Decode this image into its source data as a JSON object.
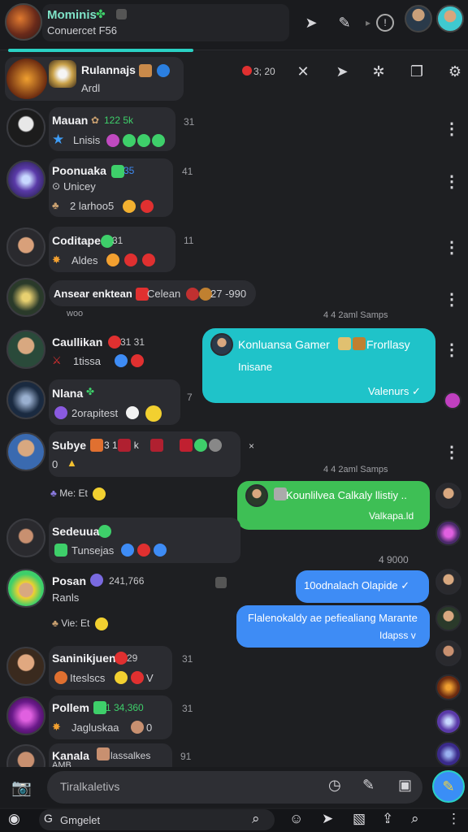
{
  "header": {
    "title": "Mominis",
    "title_emoji": "✤",
    "subtitle": "Conuercet F56",
    "icons": [
      "send-icon",
      "pencil-icon",
      "chevron-right-icon",
      "timer-icon"
    ]
  },
  "pinned": {
    "name": "Rulannajs",
    "line2": "Ardl",
    "count": "3; 20",
    "icons": [
      "close-icon",
      "send-icon",
      "settings-icon",
      "copy-icon",
      "gear-icon"
    ]
  },
  "rows": [
    {
      "name": "Mauan",
      "meta": "122 5k",
      "line2": "Lnisis",
      "num": "31"
    },
    {
      "name": "Poonuaka",
      "meta": "35",
      "line2": "Unicey",
      "line3": "2 larhoo5",
      "num": "41"
    },
    {
      "name": "Coditape",
      "meta": "31",
      "line2": "Aldes",
      "num": "11"
    },
    {
      "name": "Ansear enktean",
      "meta": "Celean",
      "extra": "27 -990",
      "sub": "woo"
    },
    {
      "name": "Caullikan",
      "meta": "31 31",
      "line2": "1tissa"
    },
    {
      "name": "Nlana",
      "line2": "2orapitest",
      "num": "7"
    },
    {
      "name": "Subye",
      "meta": "3   10   1 k",
      "line2": "0"
    },
    {
      "name": "Sedeuua",
      "line2": "Tunsejas"
    },
    {
      "name": "Posan",
      "meta": "241,766",
      "line2": "Ranls"
    },
    {
      "name": "Saninikjuen",
      "meta": "29",
      "line2": "Iteslscs",
      "tail": "V",
      "num": "31"
    },
    {
      "name": "Pollem",
      "meta": "1 34,360",
      "line2": "Jagluskaa",
      "tail": "0",
      "num": "31"
    },
    {
      "name": "Kanala",
      "meta": "lassalkes",
      "line2": "AMB",
      "num": "91"
    }
  ],
  "timestamps": [
    "4 4 2aml Samps",
    "4 4 2aml Samps",
    "4 9000"
  ],
  "side_labels": [
    "Me: Et",
    "Vie: Et"
  ],
  "side_marks": [
    "×"
  ],
  "messages": {
    "teal": {
      "title": "Konluansa Gamer",
      "title2": "Frorllasy",
      "body": "Inisane",
      "footer": "Valenurs ✓"
    },
    "green": {
      "title": "Kounlilvea Calkaly llistiy ..",
      "footer": "Valkapa.ld"
    },
    "blue1": {
      "title": "10odnalach Olapide ✓"
    },
    "blue2": {
      "title": "Flalenokaldy ae pefiealiang Marante",
      "footer": "Idapss v"
    }
  },
  "composer": {
    "placeholder": "Tiralkaletivs"
  },
  "navbar": {
    "search": "Gmgelet"
  },
  "colors": {
    "accent": "#2ad1c4",
    "green": "#3ecf6a",
    "blue": "#3e8cf5",
    "teal": "#1fc3c9",
    "bubble": "#2b2c31",
    "bg": "#1e1f22"
  }
}
